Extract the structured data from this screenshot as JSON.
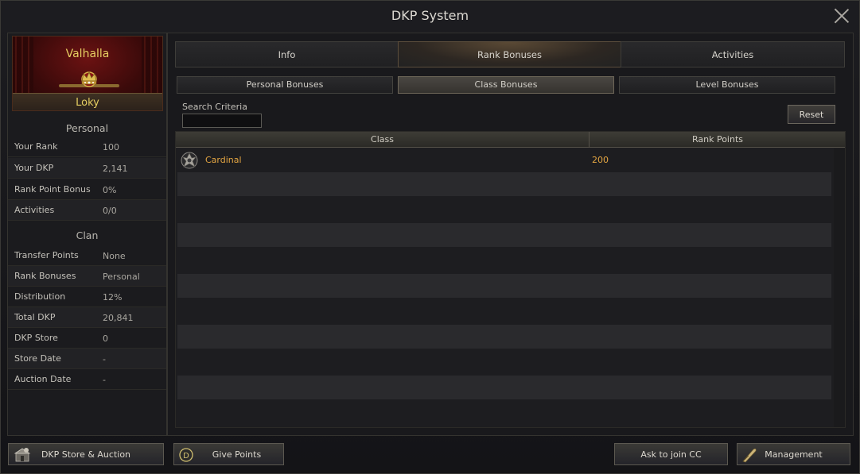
{
  "window": {
    "title": "DKP System"
  },
  "profile": {
    "clan_name": "Valhalla",
    "character_name": "Loky"
  },
  "personal": {
    "title": "Personal",
    "rows": [
      {
        "label": "Your Rank",
        "value": "100"
      },
      {
        "label": "Your DKP",
        "value": "2,141"
      },
      {
        "label": "Rank Point Bonus",
        "value": "0%"
      },
      {
        "label": "Activities",
        "value": "0/0"
      }
    ]
  },
  "clan": {
    "title": "Clan",
    "rows": [
      {
        "label": "Transfer Points",
        "value": "None"
      },
      {
        "label": "Rank Bonuses",
        "value": "Personal"
      },
      {
        "label": "Distribution",
        "value": "12%"
      },
      {
        "label": "Total DKP",
        "value": "20,841"
      },
      {
        "label": "DKP Store",
        "value": "0"
      },
      {
        "label": "Store Date",
        "value": "-"
      },
      {
        "label": "Auction Date",
        "value": "-"
      }
    ]
  },
  "tabs": [
    {
      "label": "Info"
    },
    {
      "label": "Rank Bonuses",
      "active": true
    },
    {
      "label": "Activities"
    }
  ],
  "subtabs": [
    {
      "label": "Personal Bonuses"
    },
    {
      "label": "Class Bonuses",
      "active": true
    },
    {
      "label": "Level Bonuses"
    }
  ],
  "search": {
    "label": "Search Criteria",
    "value": "",
    "reset_label": "Reset"
  },
  "table": {
    "columns": [
      "Class",
      "Rank Points"
    ],
    "rows": [
      {
        "class": "Cardinal",
        "points": "200",
        "icon": "cardinal-class-icon"
      }
    ]
  },
  "buttons": {
    "dkp_store": "DKP Store & Auction",
    "give_points": "Give Points",
    "ask_join": "Ask to join CC",
    "management": "Management"
  },
  "colors": {
    "accent_gold": "#e6cf62",
    "row_text": "#e3a542",
    "banner_red": "#6b1212"
  }
}
